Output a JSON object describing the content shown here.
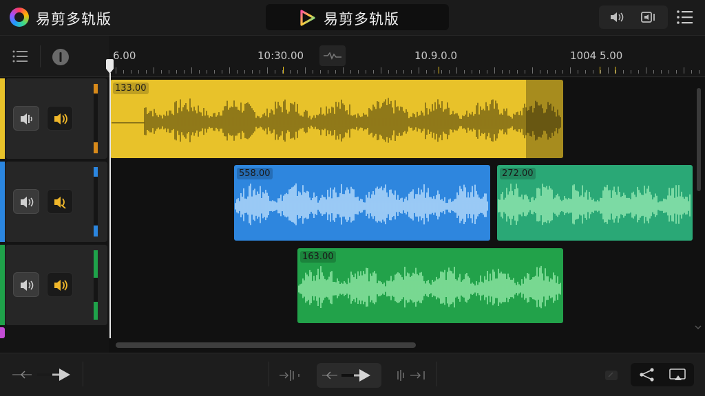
{
  "header": {
    "app_title": "易剪多轨版",
    "center_title": "易剪多轨版"
  },
  "ruler": {
    "labels": [
      "6.00",
      "10:30.00",
      "10.9.0.0",
      "1004 5.00"
    ]
  },
  "tracks": [
    {
      "color": "#e8c22a",
      "meter_color": "#d88a1a"
    },
    {
      "color": "#2b86e0",
      "meter_color": "#2b86e0"
    },
    {
      "color": "#1fa24a",
      "meter_color": "#1fa24a"
    }
  ],
  "clips": [
    {
      "label": "133.00",
      "color": "#e8c22a",
      "wave_color": "#6b5a12"
    },
    {
      "label": "558.00",
      "color": "#2e86de",
      "wave_color": "#c8e6ff"
    },
    {
      "label": "272.00",
      "color": "#2aa876",
      "wave_color": "#9ff0b8"
    },
    {
      "label": "163.00",
      "color": "#22a24a",
      "wave_color": "#9df0b0"
    }
  ],
  "icons": {
    "logo": "app-logo-icon",
    "play": "play-logo-icon",
    "volume": "volume-icon",
    "speaker_cast": "speaker-output-icon",
    "menu": "menu-icon",
    "list": "list-icon",
    "info": "info-icon",
    "share": "share-icon",
    "export": "export-icon"
  }
}
